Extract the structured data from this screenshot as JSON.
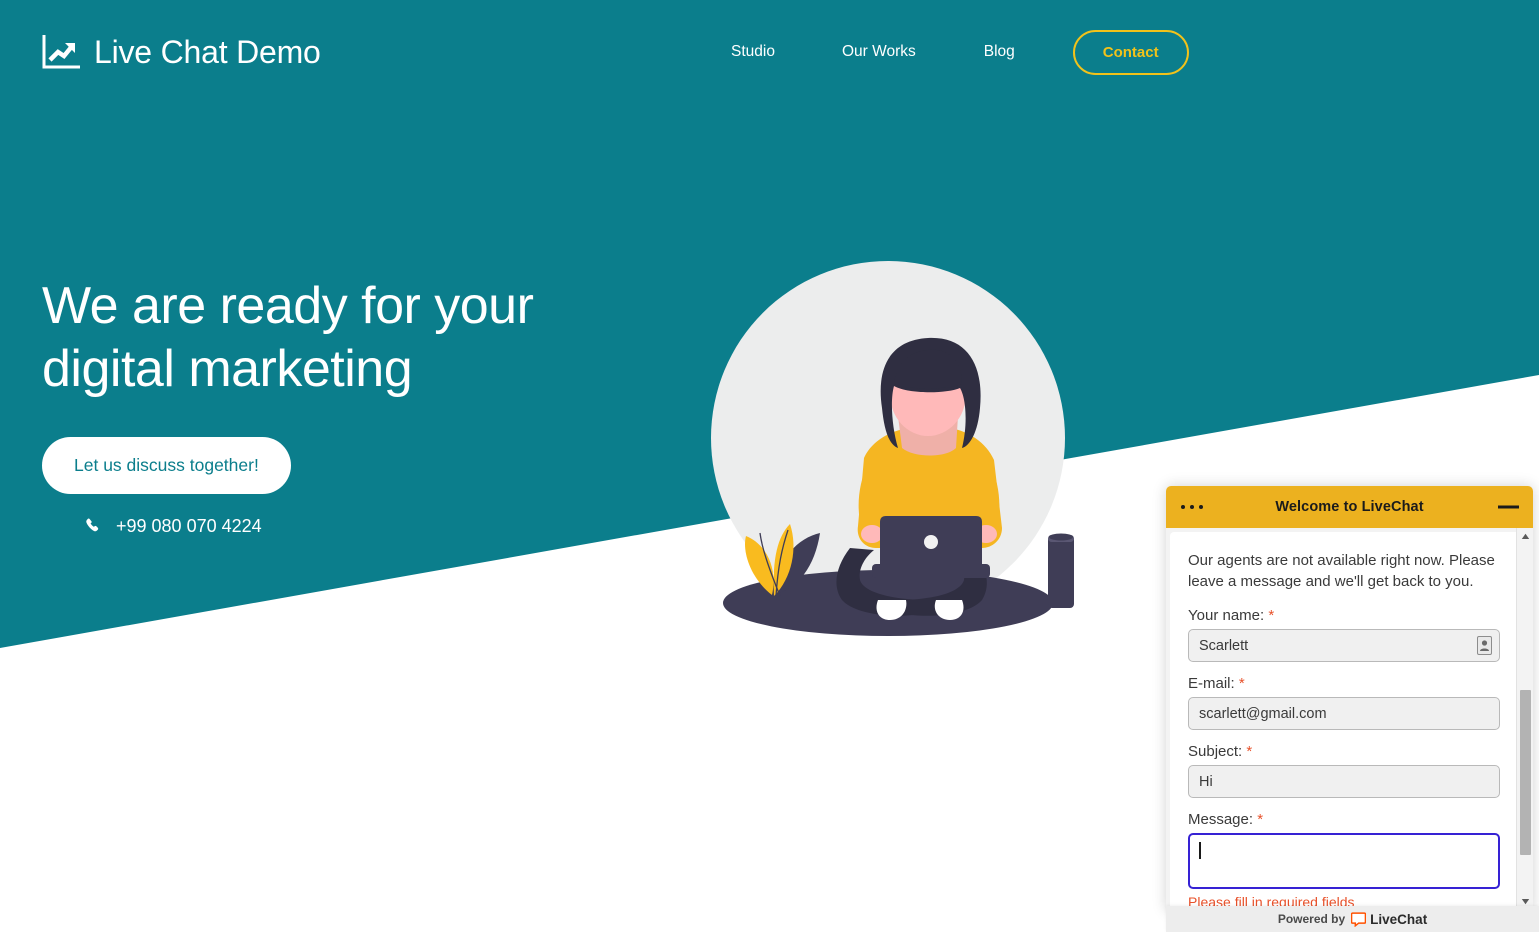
{
  "site": {
    "brand": {
      "name": "Live Chat Demo",
      "icon": "chart-line-up-icon"
    },
    "nav": {
      "links": [
        {
          "label": "Studio"
        },
        {
          "label": "Our Works"
        },
        {
          "label": "Blog"
        }
      ],
      "cta": {
        "label": "Contact"
      }
    },
    "hero": {
      "title_line1": "We are ready for your",
      "title_line2": "digital marketing",
      "cta_label": "Let us discuss together!",
      "phone": "+99 080 070 4224",
      "phone_icon": "phone-icon"
    },
    "illustration": {
      "alt": "woman sitting cross-legged working on a laptop"
    }
  },
  "colors": {
    "teal": "#0b7e8c",
    "yellow": "#ecb11f",
    "cta_yellow": "#f2c21a",
    "white": "#ffffff",
    "error_red": "#e8512a",
    "focus_blue": "#3622d4",
    "illustration_dark": "#3f3d56",
    "illustration_yellow": "#f9bb1f",
    "skin": "#ffb9b9",
    "circle_gray": "#eceded"
  },
  "chat_widget": {
    "header": {
      "title": "Welcome to LiveChat",
      "menu_icon": "ellipsis-icon",
      "minimize_icon": "minimize-icon"
    },
    "intro_message": "Our agents are not available right now. Please leave a message and we'll get back to you.",
    "fields": [
      {
        "label": "Your name:",
        "required": "*",
        "value": "Scarlett",
        "placeholder": "",
        "icon": "autofill-contact-icon"
      },
      {
        "label": "E-mail:",
        "required": "*",
        "value": "scarlett@gmail.com",
        "placeholder": ""
      },
      {
        "label": "Subject:",
        "required": "*",
        "value": "Hi",
        "placeholder": ""
      }
    ],
    "message_field": {
      "label": "Message:",
      "required": "*",
      "value": "",
      "placeholder": ""
    },
    "error": "Please fill in required fields",
    "scrollbar": {
      "up_icon": "scroll-up-arrow-icon",
      "down_icon": "scroll-down-arrow-icon"
    },
    "footer": {
      "powered_by": "Powered by",
      "product": "LiveChat",
      "logo_icon": "livechat-logo-icon"
    }
  }
}
